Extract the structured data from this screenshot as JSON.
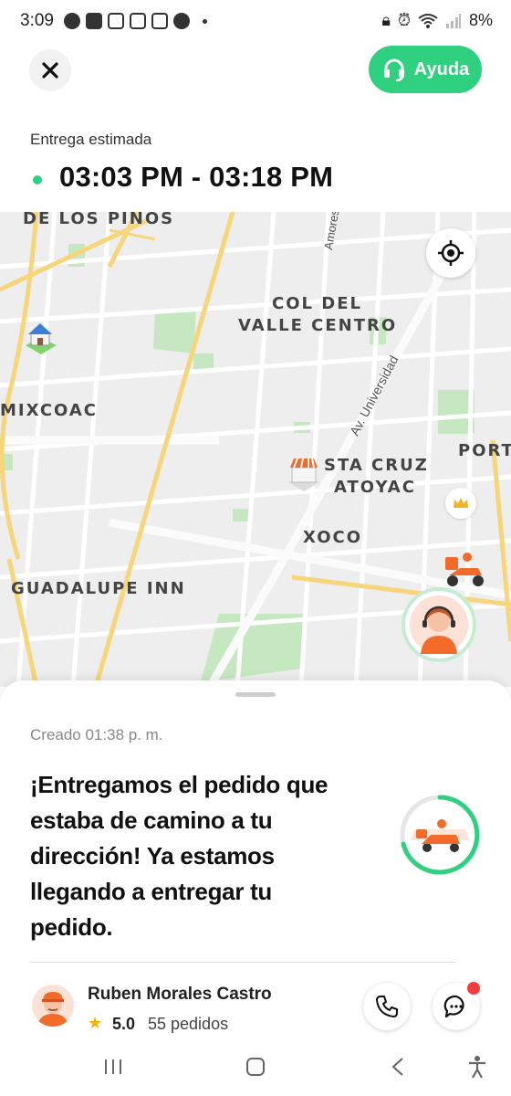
{
  "status_bar": {
    "time": "3:09",
    "battery": "8%"
  },
  "header": {
    "help_label": "Ayuda"
  },
  "eta": {
    "label": "Entrega estimada",
    "value": "03:03 PM - 03:18 PM"
  },
  "map": {
    "labels": {
      "de_los_pinos": "DE LOS PINOS",
      "amores": "Amores",
      "col_del": "COL DEL",
      "valle_centro": "VALLE CENTRO",
      "mixcoac": "MIXCOAC",
      "universidad": "Av. Universidad",
      "port": "PORT",
      "sta_cruz": "STA CRUZ",
      "atoyac": "ATOYAC",
      "xoco": "XOCO",
      "guadalupe_inn": "GUADALUPE INN"
    }
  },
  "order": {
    "created": "Creado 01:38 p. m.",
    "message": "¡Entregamos el pedido que estaba de camino a tu dirección! Ya estamos llegando a entregar tu pedido."
  },
  "driver": {
    "name": "Ruben Morales Castro",
    "rating": "5.0",
    "orders": "55 pedidos"
  },
  "colors": {
    "accent": "#2fd07f",
    "badge": "#f23c3c",
    "star": "#f5b400",
    "map_road": "#f7d57a",
    "map_park": "#c5e8c0"
  },
  "icons": {
    "close": "close-icon",
    "help": "headset-icon",
    "locate": "crosshair-icon",
    "call": "phone-icon",
    "chat": "chat-icon"
  }
}
